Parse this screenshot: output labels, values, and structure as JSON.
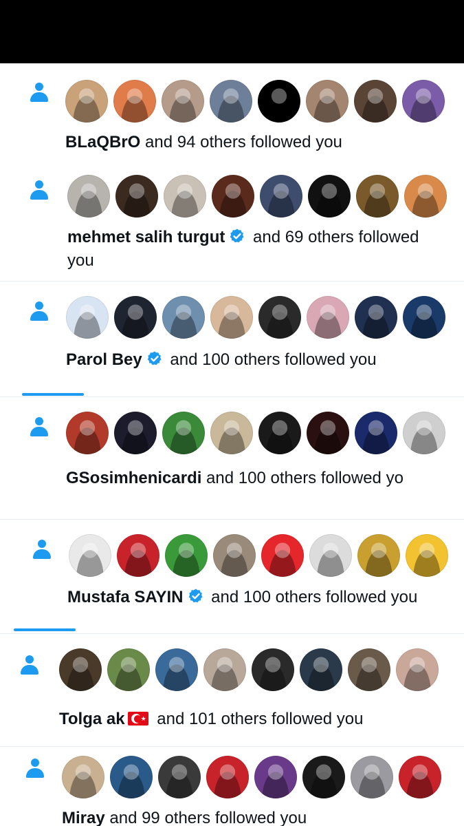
{
  "notifications": [
    {
      "bold": "BLaQBrO",
      "verified": false,
      "flag": false,
      "rest": " and 94 others followed you",
      "rest2": "",
      "avatars": [
        "#c9a27a",
        "#e07b4a",
        "#b59b8a",
        "#6e7f99",
        "#000000",
        "#a38570",
        "#5a4436",
        "#7b5ca8"
      ]
    },
    {
      "bold": "mehmet salih turgut",
      "verified": true,
      "flag": false,
      "rest": " and 69 others followed",
      "rest2": "you",
      "avatars": [
        "#b7b3ad",
        "#3a2a1f",
        "#c9c0b6",
        "#5a2a1c",
        "#3e4c6e",
        "#111111",
        "#7a5a2a",
        "#d98a4a"
      ]
    },
    {
      "bold": "Parol Bey",
      "verified": true,
      "flag": false,
      "rest": " and 100 others followed you",
      "rest2": "",
      "avatars": [
        "#d8e4f2",
        "#1e2430",
        "#6f8fae",
        "#d7b89a",
        "#2a2a2a",
        "#d9a8b4",
        "#203050",
        "#1a3a6a"
      ]
    },
    {
      "bold": "GSosimhenicardi",
      "verified": false,
      "flag": false,
      "rest": " and 100 others followed yo",
      "rest2": "",
      "avatars": [
        "#b23a2a",
        "#1c1c2c",
        "#3a8a3a",
        "#c9b89a",
        "#1a1a1a",
        "#2a1010",
        "#1a2a6a",
        "#cfcfcf"
      ]
    },
    {
      "bold": "Mustafa SAYIN",
      "verified": true,
      "flag": false,
      "rest": " and 100 others followed you",
      "rest2": "",
      "avatars": [
        "#e9e9e9",
        "#c8222a",
        "#3a9a3a",
        "#9a8a7a",
        "#e5262b",
        "#dcdcdc",
        "#c9a030",
        "#f2c230"
      ]
    },
    {
      "bold": "Tolga ak",
      "verified": false,
      "flag": true,
      "rest": " and 101 others followed you",
      "rest2": "",
      "avatars": [
        "#4a3a2a",
        "#6a8a4a",
        "#3a6a9a",
        "#b8a89a",
        "#2a2a2a",
        "#2a3a4a",
        "#6a5a4a",
        "#c9a89a"
      ]
    },
    {
      "bold": "Miray",
      "verified": false,
      "flag": false,
      "rest": " and 99 others followed you",
      "rest2": "",
      "avatars": [
        "#c9b090",
        "#2a5a8a",
        "#3a3a3a",
        "#c8222a",
        "#6a3a8a",
        "#1a1a1a",
        "#9a9aa0",
        "#c8222a"
      ]
    }
  ],
  "colors": {
    "accent": "#1d9bf0",
    "text": "#0f1419",
    "separator": "#e6ecf0",
    "topbar": "#000000"
  },
  "icons": {
    "type": "person-icon",
    "badge": "verified-badge-icon",
    "flag": "turkey-flag-icon"
  }
}
